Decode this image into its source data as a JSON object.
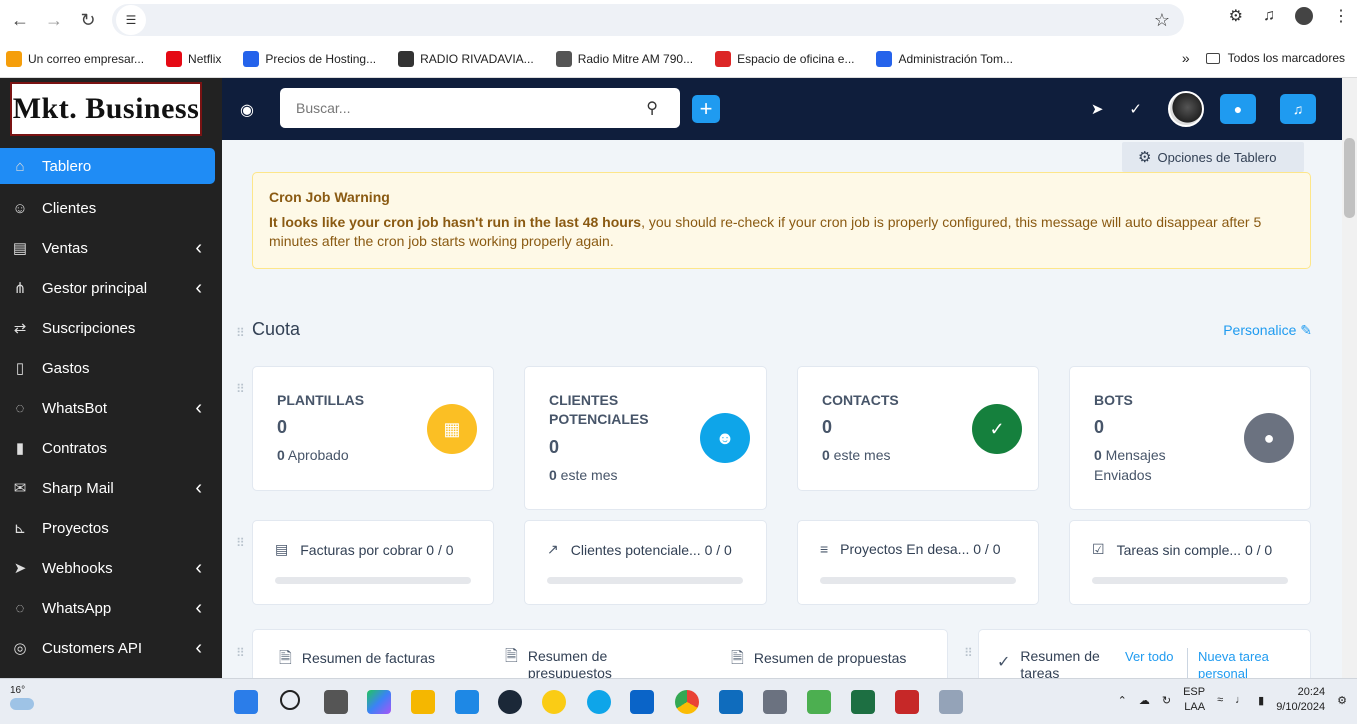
{
  "browser": {
    "bookmarks": [
      {
        "label": "Un correo empresar...",
        "icon": "dw-icon",
        "color": "#f59e0b"
      },
      {
        "label": "Netflix",
        "icon": "netflix-icon",
        "color": "#e50914"
      },
      {
        "label": "Precios de Hosting...",
        "icon": "tw-icon",
        "color": "#2563eb"
      },
      {
        "label": "RADIO RIVADAVIA...",
        "icon": "radio-icon",
        "color": "#333333"
      },
      {
        "label": "Radio Mitre AM 790...",
        "icon": "globe-icon",
        "color": "#555555"
      },
      {
        "label": "Espacio de oficina e...",
        "icon": "office-icon",
        "color": "#dc2626"
      },
      {
        "label": "Administración Tom...",
        "icon": "tw-icon",
        "color": "#2563eb"
      }
    ],
    "bookmarks_overflow": "»",
    "all_bookmarks": "Todos los marcadores"
  },
  "sidebar": {
    "logo": "Mkt. Business",
    "items": [
      {
        "label": "Tablero",
        "icon": "home-icon",
        "chevron": false
      },
      {
        "label": "Clientes",
        "icon": "user-icon",
        "chevron": false
      },
      {
        "label": "Ventas",
        "icon": "receipt-icon",
        "chevron": true
      },
      {
        "label": "Gestor principal",
        "icon": "sitemap-icon",
        "chevron": true
      },
      {
        "label": "Suscripciones",
        "icon": "repeat-icon",
        "chevron": false
      },
      {
        "label": "Gastos",
        "icon": "file-icon",
        "chevron": false
      },
      {
        "label": "WhatsBot",
        "icon": "whatsapp-icon",
        "chevron": true
      },
      {
        "label": "Contratos",
        "icon": "contract-icon",
        "chevron": false
      },
      {
        "label": "Sharp Mail",
        "icon": "mail-icon",
        "chevron": true
      },
      {
        "label": "Proyectos",
        "icon": "chart-icon",
        "chevron": false
      },
      {
        "label": "Webhooks",
        "icon": "send-icon",
        "chevron": true
      },
      {
        "label": "WhatsApp",
        "icon": "whatsapp-icon",
        "chevron": true
      },
      {
        "label": "Customers API",
        "icon": "api-icon",
        "chevron": true
      }
    ]
  },
  "topbar": {
    "search_placeholder": "Buscar..."
  },
  "dashboard": {
    "options_button": "Opciones de Tablero",
    "warning": {
      "title": "Cron Job Warning",
      "bold": "It looks like your cron job hasn't run in the last 48 hours",
      "text": ", you should re-check if your cron job is properly configured, this message will auto disappear after 5 minutes after the cron job starts working properly again."
    },
    "section_title": "Cuota",
    "personalize": "Personalice",
    "cards": [
      {
        "title": "PLANTILLAS",
        "value": "0",
        "sub_value": "0",
        "sub_text": " Aprobado",
        "color": "#fbbf24"
      },
      {
        "title": "CLIENTES POTENCIALES",
        "value": "0",
        "sub_value": "0",
        "sub_text": " este mes",
        "color": "#0ea5e9"
      },
      {
        "title": "CONTACTS",
        "value": "0",
        "sub_value": "0",
        "sub_text": " este mes",
        "color": "#15803d"
      },
      {
        "title": "BOTS",
        "value": "0",
        "sub_value": "0",
        "sub_text": " Mensajes Enviados",
        "color": "#6b7280"
      }
    ],
    "stats": [
      {
        "label": "Facturas por cobrar 0 / 0",
        "icon": "money-icon"
      },
      {
        "label": "Clientes potenciale... 0 / 0",
        "icon": "trend-icon"
      },
      {
        "label": "Proyectos En desa... 0 / 0",
        "icon": "sliders-icon"
      },
      {
        "label": "Tareas sin comple... 0 / 0",
        "icon": "task-icon"
      }
    ],
    "summaries": {
      "facturas": "Resumen de facturas",
      "presupuestos": "Resumen de presupuestos",
      "propuestas": "Resumen de propuestas",
      "tareas": "Resumen de tareas",
      "ver_todo": "Ver todo",
      "nueva_tarea": "Nueva tarea personal"
    }
  },
  "taskbar": {
    "temp": "16°",
    "lang1": "ESP",
    "lang2": "LAA",
    "time": "20:24",
    "date": "9/10/2024"
  }
}
